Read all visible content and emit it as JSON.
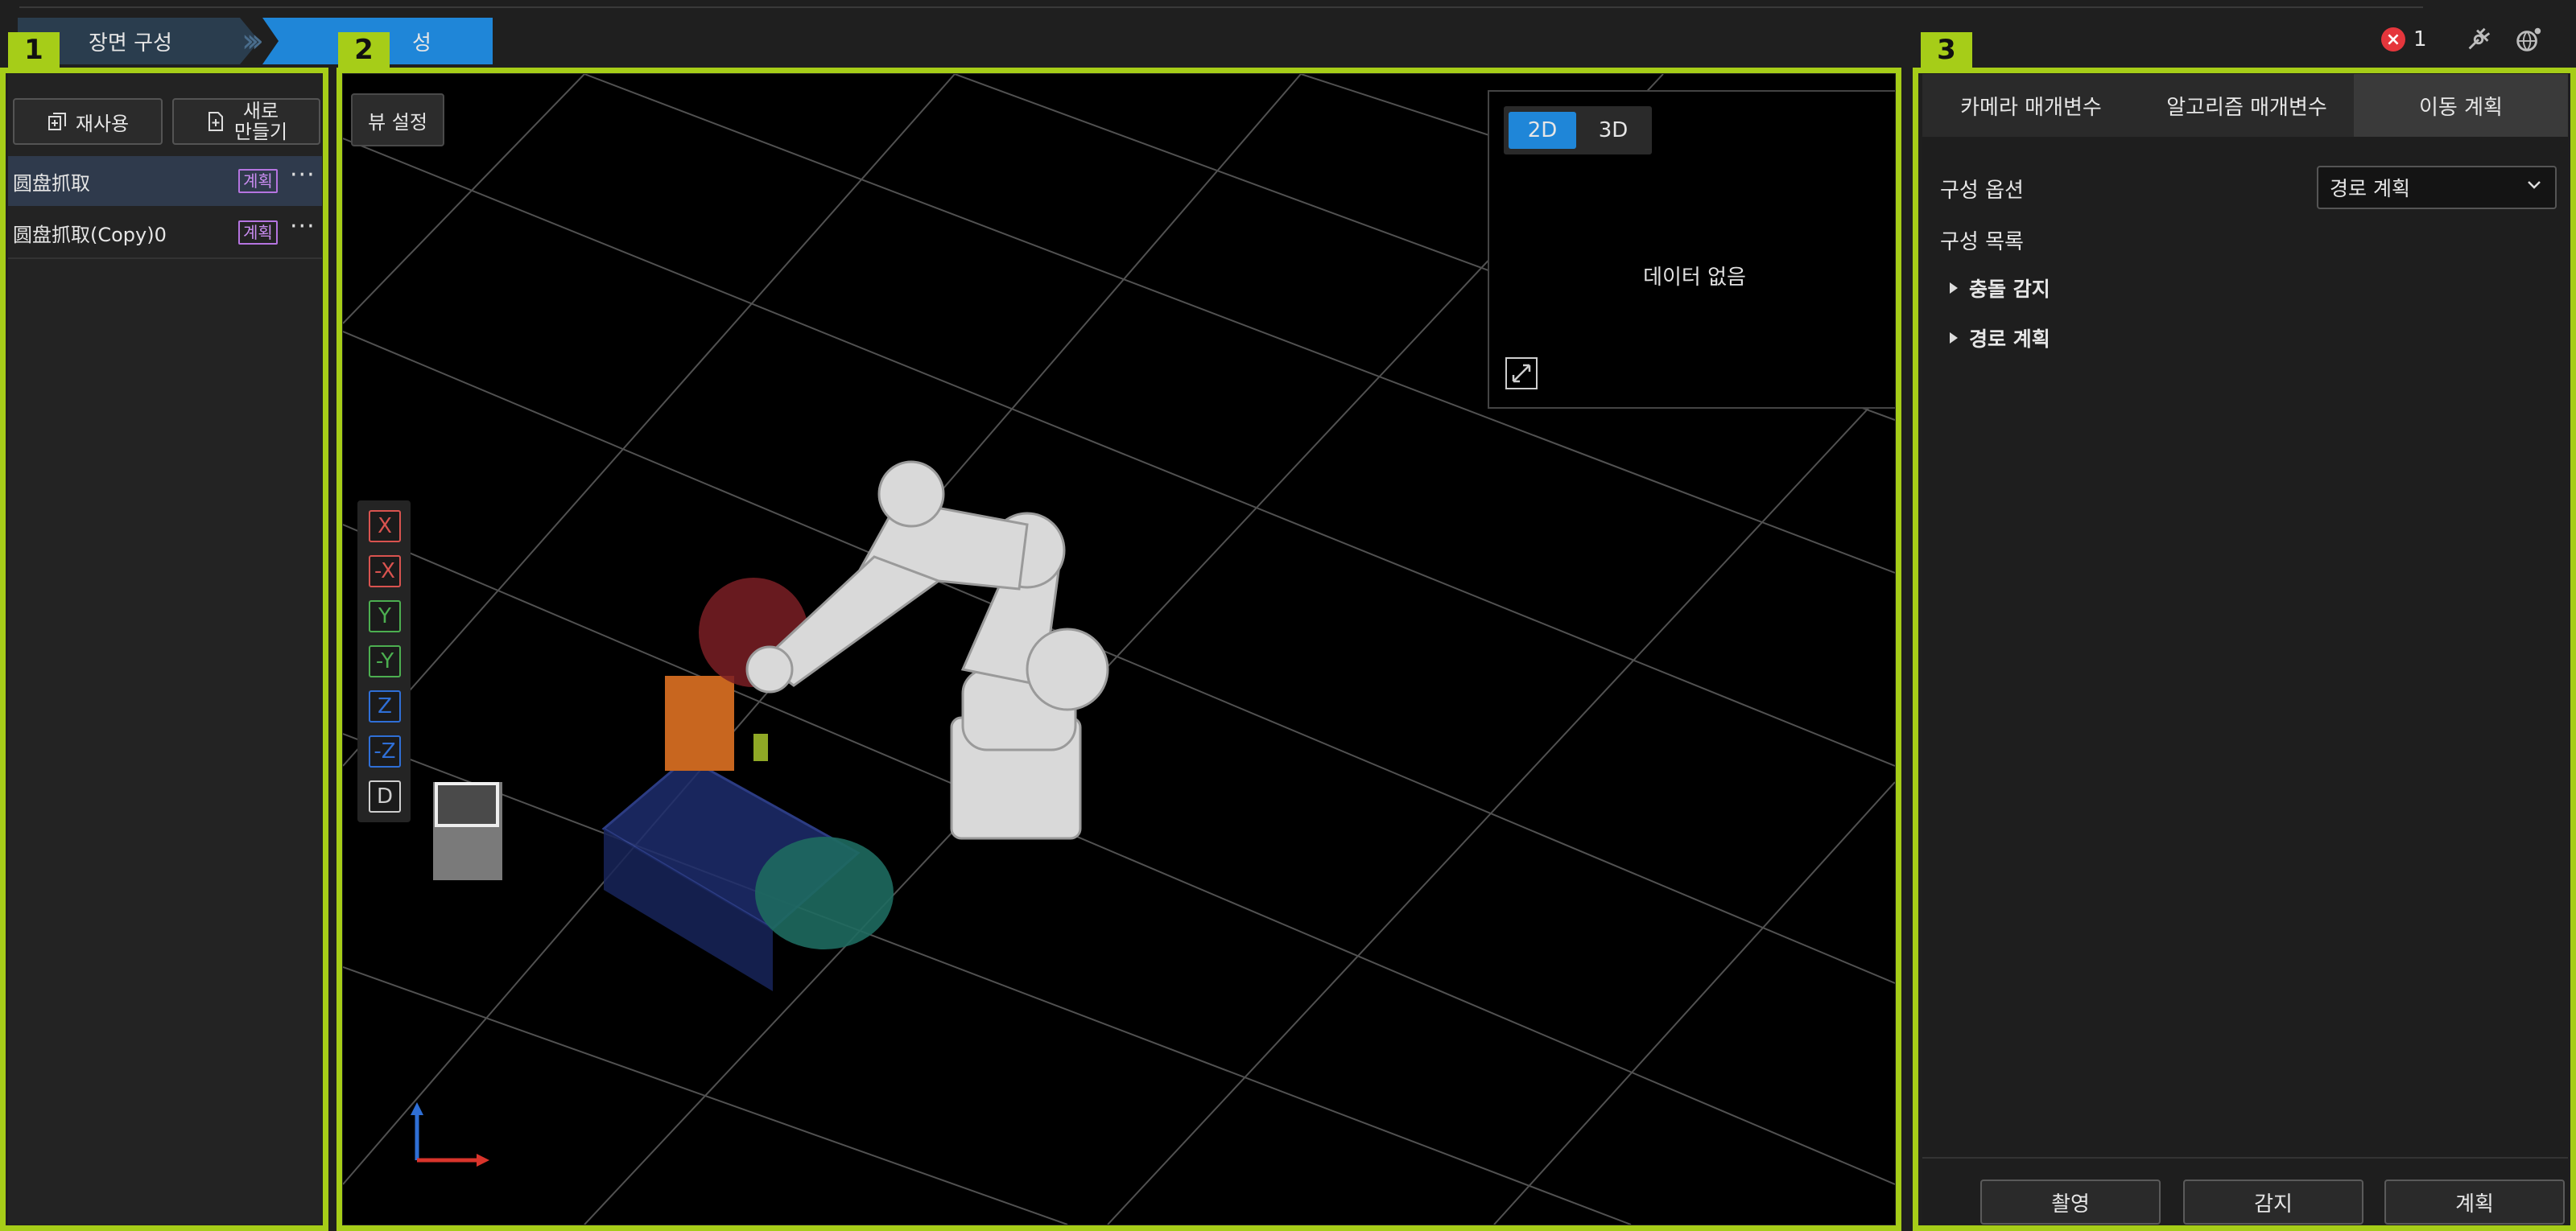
{
  "header": {
    "breadcrumb_1": "장면 구성",
    "breadcrumb_2": "성",
    "error_count": "1"
  },
  "regions": {
    "left": "1",
    "viewport": "2",
    "right": "3"
  },
  "left_panel": {
    "reuse_label": "재사용",
    "new_label_line1": "새로",
    "new_label_line2": "만들기",
    "items": [
      {
        "name": "圆盘抓取",
        "badge": "계획",
        "more": "···"
      },
      {
        "name": "圆盘抓取(Copy)0",
        "badge": "계획",
        "more": "···"
      }
    ]
  },
  "viewport": {
    "view_settings_label": "뷰 설정",
    "axis_buttons": [
      "X",
      "-X",
      "Y",
      "-Y",
      "Z",
      "-Z",
      "D"
    ],
    "axis_colors": [
      "#d9534f",
      "#d9534f",
      "#4caf50",
      "#4caf50",
      "#2f6fd6",
      "#2f6fd6",
      "#cfcfcf"
    ],
    "minimap": {
      "toggle_2d": "2D",
      "toggle_3d": "3D",
      "active": "2D",
      "no_data": "데이터 없음"
    }
  },
  "right_panel": {
    "tabs": [
      "카메라 매개변수",
      "알고리즘 매개변수",
      "이동 계획"
    ],
    "active_tab": "이동 계획",
    "config_option_label": "구성 옵션",
    "config_option_value": "경로 계획",
    "config_list_label": "구성 목록",
    "tree": [
      "충돌 감지",
      "경로 계획"
    ],
    "actions": [
      "촬영",
      "감지",
      "계획"
    ]
  },
  "colors": {
    "accent_frame": "#a6cd18",
    "breadcrumb_active": "#1f86d8",
    "badge": "#b574e0",
    "error": "#e5363c"
  }
}
